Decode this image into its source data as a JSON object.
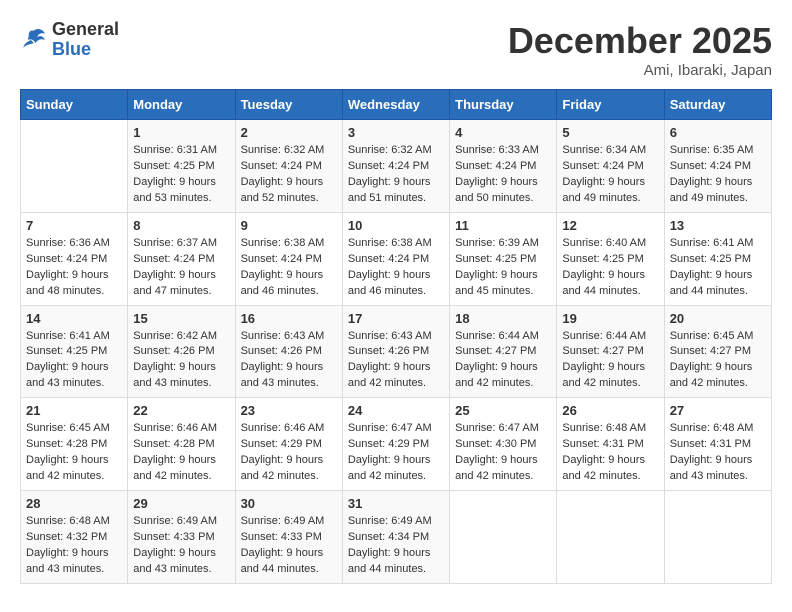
{
  "header": {
    "logo_general": "General",
    "logo_blue": "Blue",
    "month_title": "December 2025",
    "location": "Ami, Ibaraki, Japan"
  },
  "days_of_week": [
    "Sunday",
    "Monday",
    "Tuesday",
    "Wednesday",
    "Thursday",
    "Friday",
    "Saturday"
  ],
  "weeks": [
    [
      {
        "day": "",
        "info": ""
      },
      {
        "day": "1",
        "info": "Sunrise: 6:31 AM\nSunset: 4:25 PM\nDaylight: 9 hours\nand 53 minutes."
      },
      {
        "day": "2",
        "info": "Sunrise: 6:32 AM\nSunset: 4:24 PM\nDaylight: 9 hours\nand 52 minutes."
      },
      {
        "day": "3",
        "info": "Sunrise: 6:32 AM\nSunset: 4:24 PM\nDaylight: 9 hours\nand 51 minutes."
      },
      {
        "day": "4",
        "info": "Sunrise: 6:33 AM\nSunset: 4:24 PM\nDaylight: 9 hours\nand 50 minutes."
      },
      {
        "day": "5",
        "info": "Sunrise: 6:34 AM\nSunset: 4:24 PM\nDaylight: 9 hours\nand 49 minutes."
      },
      {
        "day": "6",
        "info": "Sunrise: 6:35 AM\nSunset: 4:24 PM\nDaylight: 9 hours\nand 49 minutes."
      }
    ],
    [
      {
        "day": "7",
        "info": "Sunrise: 6:36 AM\nSunset: 4:24 PM\nDaylight: 9 hours\nand 48 minutes."
      },
      {
        "day": "8",
        "info": "Sunrise: 6:37 AM\nSunset: 4:24 PM\nDaylight: 9 hours\nand 47 minutes."
      },
      {
        "day": "9",
        "info": "Sunrise: 6:38 AM\nSunset: 4:24 PM\nDaylight: 9 hours\nand 46 minutes."
      },
      {
        "day": "10",
        "info": "Sunrise: 6:38 AM\nSunset: 4:24 PM\nDaylight: 9 hours\nand 46 minutes."
      },
      {
        "day": "11",
        "info": "Sunrise: 6:39 AM\nSunset: 4:25 PM\nDaylight: 9 hours\nand 45 minutes."
      },
      {
        "day": "12",
        "info": "Sunrise: 6:40 AM\nSunset: 4:25 PM\nDaylight: 9 hours\nand 44 minutes."
      },
      {
        "day": "13",
        "info": "Sunrise: 6:41 AM\nSunset: 4:25 PM\nDaylight: 9 hours\nand 44 minutes."
      }
    ],
    [
      {
        "day": "14",
        "info": "Sunrise: 6:41 AM\nSunset: 4:25 PM\nDaylight: 9 hours\nand 43 minutes."
      },
      {
        "day": "15",
        "info": "Sunrise: 6:42 AM\nSunset: 4:26 PM\nDaylight: 9 hours\nand 43 minutes."
      },
      {
        "day": "16",
        "info": "Sunrise: 6:43 AM\nSunset: 4:26 PM\nDaylight: 9 hours\nand 43 minutes."
      },
      {
        "day": "17",
        "info": "Sunrise: 6:43 AM\nSunset: 4:26 PM\nDaylight: 9 hours\nand 42 minutes."
      },
      {
        "day": "18",
        "info": "Sunrise: 6:44 AM\nSunset: 4:27 PM\nDaylight: 9 hours\nand 42 minutes."
      },
      {
        "day": "19",
        "info": "Sunrise: 6:44 AM\nSunset: 4:27 PM\nDaylight: 9 hours\nand 42 minutes."
      },
      {
        "day": "20",
        "info": "Sunrise: 6:45 AM\nSunset: 4:27 PM\nDaylight: 9 hours\nand 42 minutes."
      }
    ],
    [
      {
        "day": "21",
        "info": "Sunrise: 6:45 AM\nSunset: 4:28 PM\nDaylight: 9 hours\nand 42 minutes."
      },
      {
        "day": "22",
        "info": "Sunrise: 6:46 AM\nSunset: 4:28 PM\nDaylight: 9 hours\nand 42 minutes."
      },
      {
        "day": "23",
        "info": "Sunrise: 6:46 AM\nSunset: 4:29 PM\nDaylight: 9 hours\nand 42 minutes."
      },
      {
        "day": "24",
        "info": "Sunrise: 6:47 AM\nSunset: 4:29 PM\nDaylight: 9 hours\nand 42 minutes."
      },
      {
        "day": "25",
        "info": "Sunrise: 6:47 AM\nSunset: 4:30 PM\nDaylight: 9 hours\nand 42 minutes."
      },
      {
        "day": "26",
        "info": "Sunrise: 6:48 AM\nSunset: 4:31 PM\nDaylight: 9 hours\nand 42 minutes."
      },
      {
        "day": "27",
        "info": "Sunrise: 6:48 AM\nSunset: 4:31 PM\nDaylight: 9 hours\nand 43 minutes."
      }
    ],
    [
      {
        "day": "28",
        "info": "Sunrise: 6:48 AM\nSunset: 4:32 PM\nDaylight: 9 hours\nand 43 minutes."
      },
      {
        "day": "29",
        "info": "Sunrise: 6:49 AM\nSunset: 4:33 PM\nDaylight: 9 hours\nand 43 minutes."
      },
      {
        "day": "30",
        "info": "Sunrise: 6:49 AM\nSunset: 4:33 PM\nDaylight: 9 hours\nand 44 minutes."
      },
      {
        "day": "31",
        "info": "Sunrise: 6:49 AM\nSunset: 4:34 PM\nDaylight: 9 hours\nand 44 minutes."
      },
      {
        "day": "",
        "info": ""
      },
      {
        "day": "",
        "info": ""
      },
      {
        "day": "",
        "info": ""
      }
    ]
  ]
}
